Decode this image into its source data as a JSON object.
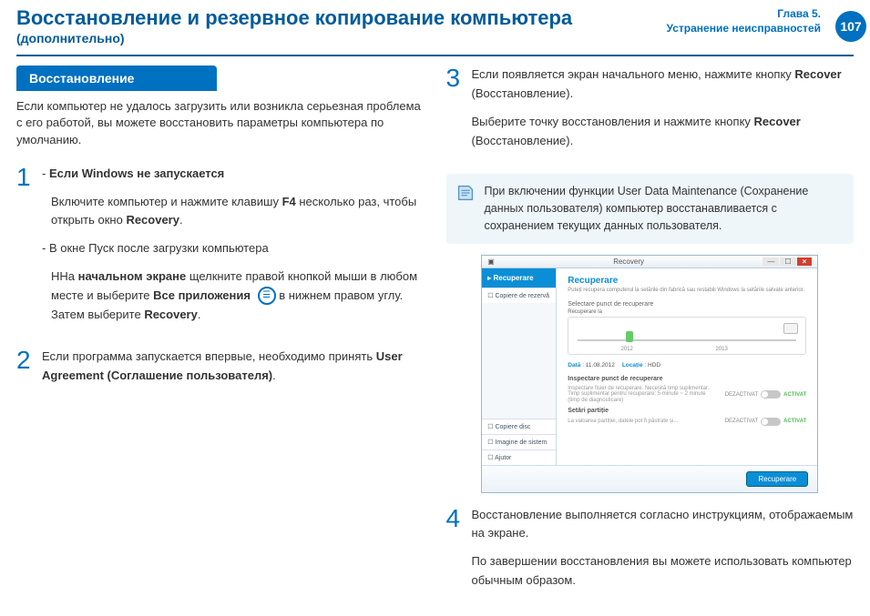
{
  "header": {
    "title": "Восстановление и резервное копирование компьютера",
    "subtitle": "(дополнительно)",
    "chapter": "Глава 5.",
    "chapter_sub": "Устранение неисправностей",
    "page": "107"
  },
  "left": {
    "pill": "Восстановление",
    "intro": "Если компьютер не удалось загрузить или возникла серьезная проблема с его работой, вы можете восстановить параметры компьютера по умолчанию.",
    "step1": {
      "bullet1_head": "Если Windows не запускается",
      "bullet1_body_a": "Включите компьютер и нажмите клавишу ",
      "bullet1_key": "F4",
      "bullet1_body_b": " несколько раз, чтобы открыть окно ",
      "bullet1_bold": "Recovery",
      "bullet1_end": ".",
      "bullet2_head": "В окне Пуск после загрузки компьютера",
      "bullet2_a": "ННа ",
      "bullet2_b": "начальном экране",
      "bullet2_c": " щелкните правой кнопкой мыши в любом месте и выберите ",
      "bullet2_d": "Все приложения",
      "bullet2_e": " в нижнем правом углу. Затем выберите ",
      "bullet2_f": "Recovery",
      "bullet2_g": "."
    },
    "step2": {
      "a": "Если программа запускается впервые, необходимо принять ",
      "b": "User Agreement (Соглашение пользователя)",
      "c": "."
    }
  },
  "right": {
    "step3": {
      "a": "Если появляется экран начального меню, нажмите кнопку ",
      "b": "Recover",
      "c": " (Восстановление).",
      "d": "Выберите точку восстановления и нажмите кнопку ",
      "e": "Recover",
      "f": " (Восстановление)."
    },
    "info": "При включении функции User Data Maintenance (Сохранение данных пользователя) компьютер восстанавливается с сохранением текущих данных пользователя.",
    "step4": {
      "a": "Восстановление выполняется согласно инструкциям, отображаемым на экране.",
      "b": "По завершении восстановления вы можете использовать компьютер обычным образом."
    }
  },
  "screenshot": {
    "window_title": "Recovery",
    "side_tab1": "Recuperare",
    "side_tab2": "Copiere de rezervă",
    "side_b1": "Copiere disc",
    "side_b2": "Imagine de sistem",
    "side_b3": "Ajutor",
    "h": "Recuperare",
    "desc": "Puteți recupera computerul la setările din fabrică sau restabili Windows la setările salvate anterior.",
    "sec1": "Selectare punct de recuperare",
    "sec1b": "Recuperare la",
    "y1": "2012",
    "y2": "2013",
    "meta_date_l": "Dată",
    "meta_date_v": "11.08.2012",
    "meta_loc_l": "Locație",
    "meta_loc_v": "HDD",
    "opt_h": "Inspectare punct de recuperare",
    "opt1": "Inspectare fișier de recuperare. Necesită timp suplimentar. Timp suplimentar pentru recuperare: 5 minute ~ 2 minute (timp de diagnosticare)",
    "opt_h2": "Setări partiție",
    "opt2": "La valoarea partiției, datele pot fi păstrate și...",
    "toggle_off": "DEZACTIVAT",
    "toggle_on": "ACTIVAT",
    "btn": "Recuperare"
  }
}
